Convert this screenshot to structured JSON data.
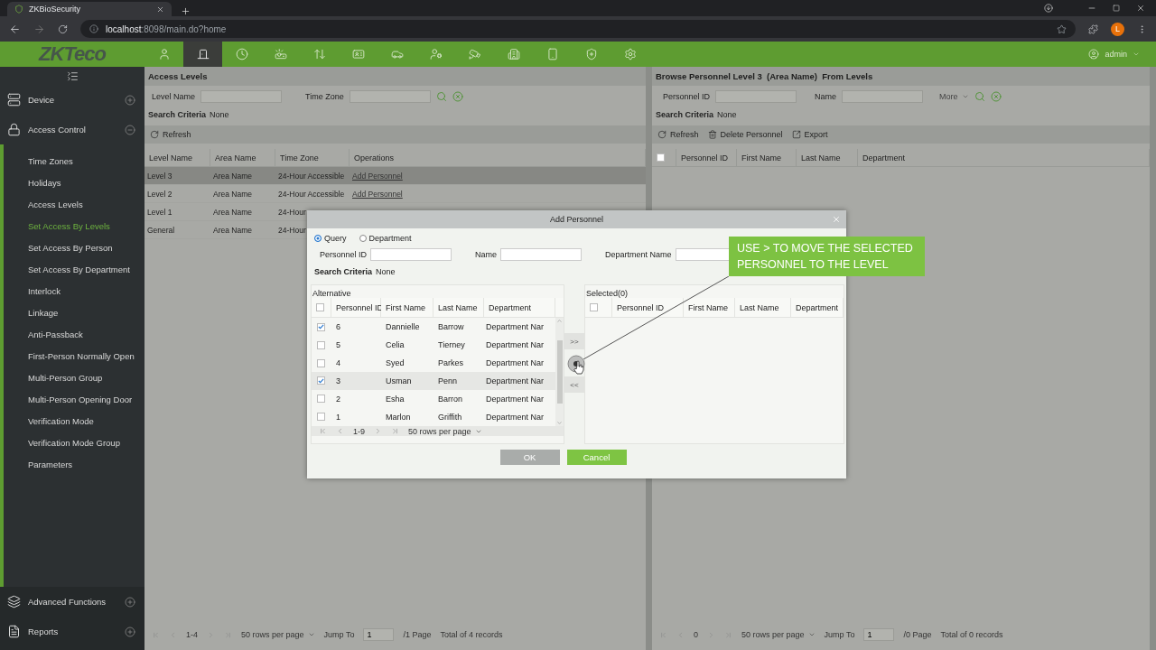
{
  "browser": {
    "tab_title": "ZKBioSecurity",
    "url": "**localhost**:8098/main.do?home",
    "avatar": "L"
  },
  "header": {
    "logo": "ZKTeco",
    "user": "admin",
    "modules": [
      {
        "selected": false
      },
      {
        "selected": true
      },
      {
        "selected": false
      },
      {
        "selected": false
      },
      {
        "selected": false
      },
      {
        "selected": false
      },
      {
        "selected": false
      },
      {
        "selected": false
      },
      {
        "selected": false
      },
      {
        "selected": false
      },
      {
        "selected": false
      },
      {
        "selected": false
      },
      {
        "selected": false
      }
    ]
  },
  "sidebar": {
    "sections": [
      {
        "label": "Device",
        "expanded": false
      },
      {
        "label": "Access Control",
        "expanded": true,
        "children": [
          {
            "label": "Time Zones",
            "selected": false
          },
          {
            "label": "Holidays",
            "selected": false
          },
          {
            "label": "Access Levels",
            "selected": false
          },
          {
            "label": "Set Access By Levels",
            "selected": true
          },
          {
            "label": "Set Access By Person",
            "selected": false
          },
          {
            "label": "Set Access By Department",
            "selected": false
          },
          {
            "label": "Interlock",
            "selected": false
          },
          {
            "label": "Linkage",
            "selected": false
          },
          {
            "label": "Anti-Passback",
            "selected": false
          },
          {
            "label": "First-Person Normally Open",
            "selected": false
          },
          {
            "label": "Multi-Person Group",
            "selected": false
          },
          {
            "label": "Multi-Person Opening Door",
            "selected": false
          },
          {
            "label": "Verification Mode",
            "selected": false
          },
          {
            "label": "Verification Mode Group",
            "selected": false
          },
          {
            "label": "Parameters",
            "selected": false
          }
        ]
      }
    ],
    "footer_sections": [
      {
        "label": "Advanced Functions",
        "expanded": false
      },
      {
        "label": "Reports",
        "expanded": false
      }
    ]
  },
  "access_levels": {
    "title": "Access Levels",
    "filters": [
      {
        "label": "Level Name"
      },
      {
        "label": "Time Zone"
      }
    ],
    "search_criteria": {
      "label": "Search Criteria",
      "value": "None"
    },
    "toolbar": [
      "Refresh"
    ],
    "columns": [
      "Level Name",
      "Area Name",
      "Time Zone",
      "Operations"
    ],
    "rows": [
      {
        "level_name": "Level 3",
        "area_name": "Area Name",
        "time_zone": "24-Hour Accessible",
        "operation": "Add Personnel",
        "selected": true
      },
      {
        "level_name": "Level 2",
        "area_name": "Area Name",
        "time_zone": "24-Hour Accessible",
        "operation": "Add Personnel",
        "selected": false
      },
      {
        "level_name": "Level 1",
        "area_name": "Area Name",
        "time_zone": "24-Hour",
        "selected": false
      },
      {
        "level_name": "General",
        "area_name": "Area Name",
        "time_zone": "24-Hour",
        "selected": false
      }
    ],
    "pager": {
      "range": "1-4",
      "rows_per_page": "50 rows per page",
      "jump_label": "Jump To",
      "jump_value": "1",
      "page_count": "/1 Page",
      "total": "Total of 4 records"
    }
  },
  "browse_personnel": {
    "title": "Browse Personnel Level 3  (Area Name)  From Levels",
    "filters": [
      {
        "label": "Personnel ID"
      },
      {
        "label": "Name"
      }
    ],
    "more": "More",
    "search_criteria": {
      "label": "Search Criteria",
      "value": "None"
    },
    "toolbar": [
      "Refresh",
      "Delete Personnel",
      "Export"
    ],
    "columns": [
      "Personnel ID",
      "First Name",
      "Last Name",
      "Department"
    ],
    "select_all_checked": false,
    "pager": {
      "range": "0",
      "rows_per_page": "50 rows per page",
      "jump_label": "Jump To",
      "jump_value": "1",
      "page_count": "/0 Page",
      "total": "Total of 0 records"
    }
  },
  "dialog": {
    "title": "Add Personnel",
    "modes": [
      {
        "label": "Query",
        "selected": true
      },
      {
        "label": "Department",
        "selected": false
      }
    ],
    "fields": [
      {
        "label": "Personnel ID"
      },
      {
        "label": "Name"
      },
      {
        "label": "Department Name"
      }
    ],
    "search_criteria": {
      "label": "Search Criteria",
      "value": "None"
    },
    "alternative": {
      "title": "Alternative",
      "columns": [
        "Personnel ID",
        "First Name",
        "Last Name",
        "Department"
      ],
      "select_all_checked": false,
      "rows": [
        {
          "id": "6",
          "first_name": "Dannielle",
          "last_name": "Barrow",
          "department": "Department Nar",
          "checked": true,
          "selected": false
        },
        {
          "id": "5",
          "first_name": "Celia",
          "last_name": "Tierney",
          "department": "Department Nar",
          "checked": false,
          "selected": false
        },
        {
          "id": "4",
          "first_name": "Syed",
          "last_name": "Parkes",
          "department": "Department Nar",
          "checked": false,
          "selected": false
        },
        {
          "id": "3",
          "first_name": "Usman",
          "last_name": "Penn",
          "department": "Department Nar",
          "checked": true,
          "selected": true
        },
        {
          "id": "2",
          "first_name": "Esha",
          "last_name": "Barron",
          "department": "Department Nar",
          "checked": false,
          "selected": false
        },
        {
          "id": "1",
          "first_name": "Marlon",
          "last_name": "Griffith",
          "department": "Department Nar",
          "checked": false,
          "selected": false
        }
      ],
      "pager": {
        "range": "1-9",
        "rows_per_page": "50 rows per page"
      }
    },
    "move_buttons": [
      ">>",
      "<<"
    ],
    "selected": {
      "title": "Selected(0)",
      "columns": [
        "Personnel ID",
        "First Name",
        "Last Name",
        "Department"
      ],
      "select_all_checked": false
    },
    "buttons": [
      {
        "label": "OK",
        "disabled": true
      },
      {
        "label": "Cancel",
        "disabled": false
      }
    ]
  },
  "callout": "USE > TO MOVE THE SELECTED\nPERSONNEL TO THE LEVEL"
}
